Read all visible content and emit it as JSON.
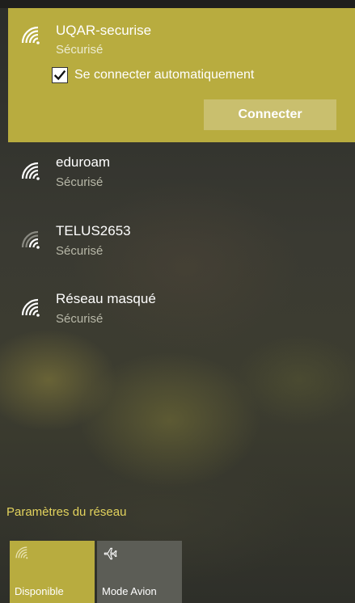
{
  "networks": [
    {
      "name": "UQAR-securise",
      "status": "Sécurisé",
      "auto_connect_label": "Se connecter automatiquement",
      "auto_connect_checked": true,
      "connect_label": "Connecter"
    },
    {
      "name": "eduroam",
      "status": "Sécurisé"
    },
    {
      "name": "TELUS2653",
      "status": "Sécurisé"
    },
    {
      "name": "Réseau masqué",
      "status": "Sécurisé"
    }
  ],
  "settings_link": "Paramètres du réseau",
  "quick_actions": [
    {
      "label": "Disponible",
      "icon": "wifi-icon",
      "active": true
    },
    {
      "label": "Mode Avion",
      "icon": "airplane-icon",
      "active": false
    }
  ],
  "colors": {
    "accent": "#b8ac3f",
    "link": "#e3d35d"
  }
}
